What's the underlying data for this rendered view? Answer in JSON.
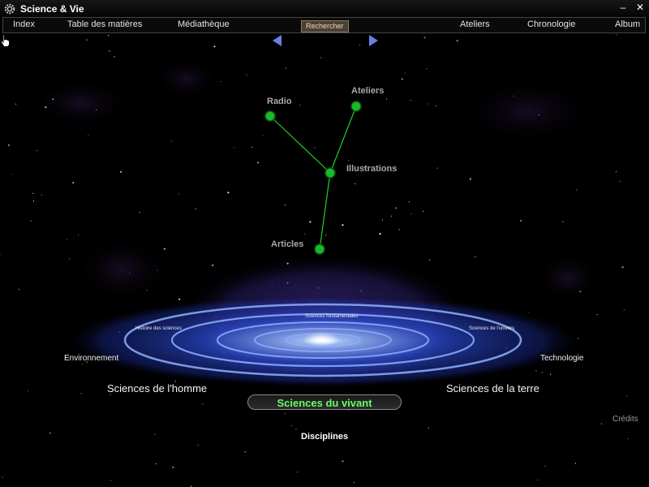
{
  "window": {
    "title": "Science & Vie",
    "minimize_label": "–",
    "close_label": "✕"
  },
  "menu": {
    "items": [
      "Index",
      "Table des matières",
      "Médiathèque",
      "Ateliers",
      "Chronologie",
      "Album"
    ],
    "search_label": "Rechercher"
  },
  "nodes": {
    "radio": "Radio",
    "ateliers": "Ateliers",
    "illustrations": "Illustrations",
    "articles": "Articles"
  },
  "disciplines": {
    "fondamentales": "Sciences fondamentales",
    "histoire": "Histoire des sciences",
    "univers": "Sciences de l'univers",
    "environnement": "Environnement",
    "technologie": "Technologie",
    "homme": "Sciences de l'homme",
    "terre": "Sciences de la terre",
    "selected": "Sciences du vivant"
  },
  "navigator": {
    "label": "Disciplines"
  },
  "credits": "Crédits",
  "colors": {
    "node_green": "#22dd33",
    "ring_blue": "#5b8cff",
    "selected_text": "#66ff66"
  }
}
